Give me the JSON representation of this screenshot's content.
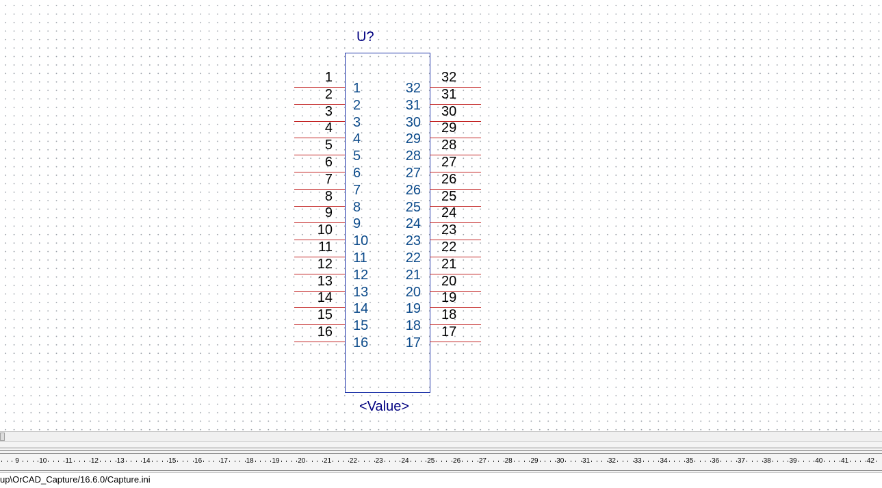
{
  "schematic": {
    "ref_designator": "U?",
    "value": "<Value>",
    "left_pins": [
      {
        "number": "1",
        "name": "1"
      },
      {
        "number": "2",
        "name": "2"
      },
      {
        "number": "3",
        "name": "3"
      },
      {
        "number": "4",
        "name": "4"
      },
      {
        "number": "5",
        "name": "5"
      },
      {
        "number": "6",
        "name": "6"
      },
      {
        "number": "7",
        "name": "7"
      },
      {
        "number": "8",
        "name": "8"
      },
      {
        "number": "9",
        "name": "9"
      },
      {
        "number": "10",
        "name": "10"
      },
      {
        "number": "11",
        "name": "11"
      },
      {
        "number": "12",
        "name": "12"
      },
      {
        "number": "13",
        "name": "13"
      },
      {
        "number": "14",
        "name": "14"
      },
      {
        "number": "15",
        "name": "15"
      },
      {
        "number": "16",
        "name": "16"
      }
    ],
    "right_pins": [
      {
        "number": "32",
        "name": "32"
      },
      {
        "number": "31",
        "name": "31"
      },
      {
        "number": "30",
        "name": "30"
      },
      {
        "number": "29",
        "name": "29"
      },
      {
        "number": "28",
        "name": "28"
      },
      {
        "number": "27",
        "name": "27"
      },
      {
        "number": "26",
        "name": "26"
      },
      {
        "number": "25",
        "name": "25"
      },
      {
        "number": "24",
        "name": "24"
      },
      {
        "number": "23",
        "name": "23"
      },
      {
        "number": "22",
        "name": "22"
      },
      {
        "number": "21",
        "name": "21"
      },
      {
        "number": "20",
        "name": "20"
      },
      {
        "number": "19",
        "name": "19"
      },
      {
        "number": "18",
        "name": "18"
      },
      {
        "number": "17",
        "name": "17"
      }
    ]
  },
  "ruler": {
    "labels": [
      "9",
      "10",
      "11",
      "12",
      "13",
      "14",
      "15",
      "16",
      "17",
      "18",
      "19",
      "20",
      "21",
      "22",
      "23",
      "24",
      "25",
      "26",
      "27",
      "28",
      "29",
      "30",
      "31",
      "32",
      "33",
      "34",
      "35",
      "36",
      "37",
      "38",
      "39",
      "40",
      "41",
      "42"
    ]
  },
  "status_bar": {
    "text": "up\\OrCAD_Capture/16.6.0/Capture.ini"
  },
  "colors": {
    "pin_line": "#c22222",
    "pin_name": "#0b4a8a",
    "body_border": "#1f35a8",
    "ref_text": "#000080"
  }
}
